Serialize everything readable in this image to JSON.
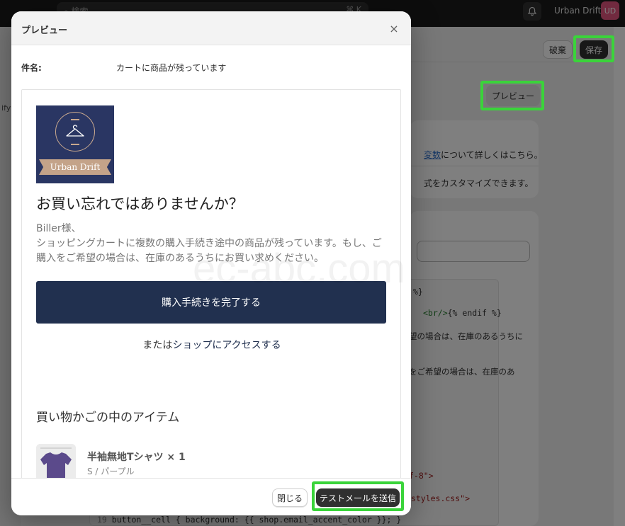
{
  "topbar": {
    "search_placeholder": "検索",
    "search_shortcut": "⌘ K",
    "store_name": "Urban Drift",
    "avatar_initials": "UD"
  },
  "sidebar": {
    "fragment": "ify"
  },
  "header": {
    "discard_label": "破棄",
    "save_label": "保存"
  },
  "page": {
    "preview_button": "プレビュー",
    "info_text_link": "変数",
    "info_text_rest": "について詳しくはこちら。",
    "info_text_2": "式をカスタマイズできます。"
  },
  "code": {
    "line_a": "%}",
    "line_b_tag": "<br/>",
    "line_b_rest": "{% endif %}",
    "line_c": "望の場合は、在庫のあるうちに",
    "line_d": "をご希望の場合は、在庫のあ",
    "line_e": "f-8\">",
    "line_f": "/styles.css\">",
    "line_num": "19",
    "line_g": "button__cell { background: {{ shop.email_accent_color }}; }"
  },
  "modal": {
    "title": "プレビュー",
    "close_glyph": "×",
    "subject_label": "件名:",
    "subject_value": "カートに商品が残っています",
    "email": {
      "logo_text": "Urban Drift",
      "headline": "お買い忘れではありませんか？",
      "greeting": "Biller様、",
      "body": "ショッピングカートに複数の購入手続き途中の商品が残っています。もし、ご購入をご希望の場合は、在庫のあるうちにお買い求めください。",
      "cta_label": "購入手続きを完了する",
      "alt_prefix": "または",
      "alt_link": "ショップにアクセスする",
      "items_title": "買い物かごの中のアイテム",
      "item_name": "半袖無地Tシャツ × 1",
      "item_variant": "S / パープル"
    },
    "footer": {
      "close_label": "閉じる",
      "send_label": "テストメールを送信"
    }
  },
  "watermark": "ec-abc.com",
  "colors": {
    "highlight": "#3ad43a",
    "brand_navy": "#21304f",
    "logo_bg": "#2a3663",
    "logo_accent": "#c4a389",
    "shirt": "#5b4a8b"
  }
}
